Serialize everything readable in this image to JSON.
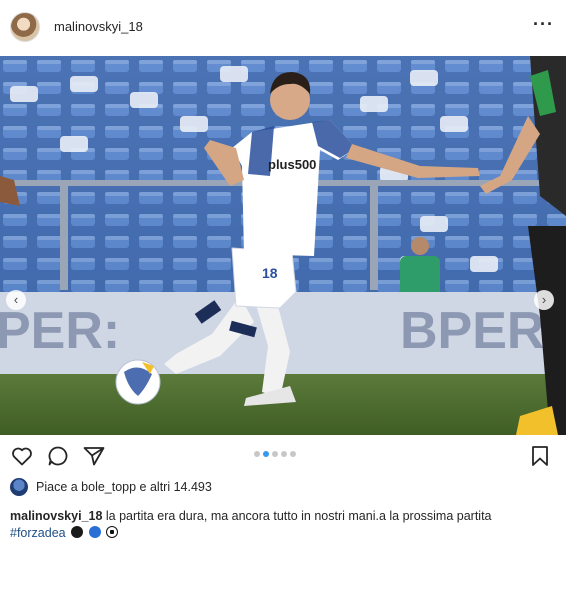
{
  "post": {
    "username": "malinovskyi_18",
    "more_label": "···"
  },
  "photo": {
    "jersey_sponsor": "plus500",
    "jersey_number": "18",
    "banner_left": "PER:",
    "banner_right": "BPER:",
    "prev_label": "‹",
    "next_label": "›"
  },
  "carousel": {
    "count": 5,
    "active_index": 1
  },
  "likes": {
    "text": "Piace a bole_topp e altri 14.493"
  },
  "caption": {
    "username": "malinovskyi_18",
    "text": " la partita era dura, ma ancora tutto in nostri mani.a la prossima partita",
    "hashtag": "#forzadea"
  },
  "icons": {
    "like": "heart-icon",
    "comment": "comment-icon",
    "share": "paper-plane-icon",
    "save": "bookmark-icon",
    "more": "more-dots-icon"
  },
  "colors": {
    "active_dot": "#3897f0",
    "hashtag": "#1f4f86",
    "text": "#262626"
  }
}
